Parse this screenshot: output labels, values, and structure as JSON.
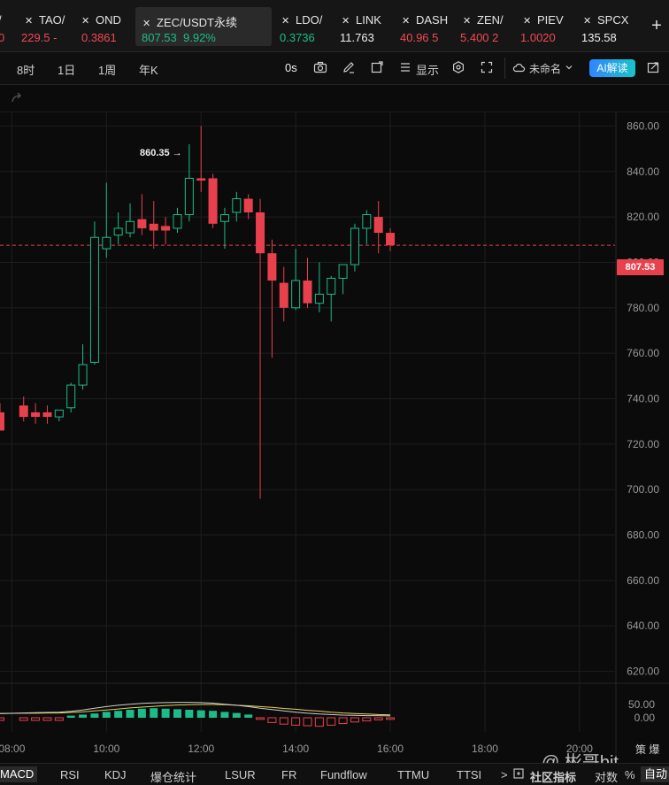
{
  "tickers": [
    {
      "symbol": "/",
      "price": "0",
      "change": "",
      "price_color": "#f24957",
      "change_color": "#f24957"
    },
    {
      "symbol": "TAO/",
      "price": "229.5",
      "change": "-",
      "price_color": "#f24957",
      "change_color": "#f24957"
    },
    {
      "symbol": "OND",
      "price": "0.3861",
      "change": "",
      "price_color": "#f24957",
      "change_color": "#f24957"
    },
    {
      "symbol": "ZEC/USDT永续",
      "price": "807.53",
      "change": "9.92%",
      "price_color": "#1dbb8a",
      "change_color": "#1dbb8a"
    },
    {
      "symbol": "LDO/",
      "price": "0.3736",
      "change": "",
      "price_color": "#1dbb8a",
      "change_color": "#1dbb8a"
    },
    {
      "symbol": "LINK",
      "price": "11.763",
      "change": "",
      "price_color": "#f0f0f0",
      "change_color": "#f0f0f0"
    },
    {
      "symbol": "DASH",
      "price": "40.96",
      "change": "5",
      "price_color": "#f24957",
      "change_color": "#f24957"
    },
    {
      "symbol": "ZEN/",
      "price": "5.400",
      "change": "2",
      "price_color": "#f24957",
      "change_color": "#f24957"
    },
    {
      "symbol": "PIEV",
      "price": "1.0020",
      "change": "",
      "price_color": "#f24957",
      "change_color": "#f24957"
    },
    {
      "symbol": "SPCX",
      "price": "135.58",
      "change": "",
      "price_color": "#f0f0f0",
      "change_color": "#f0f0f0"
    }
  ],
  "toolbar": {
    "interval_8h": "8时",
    "interval_1d": "1日",
    "interval_1w": "1周",
    "interval_1y": "年K",
    "timer": "0s",
    "display": "显示",
    "template": "未命名",
    "ai": "AI解读"
  },
  "bottom_tabs": [
    "MACD",
    "RSI",
    "KDJ",
    "爆仓统计",
    "LSUR",
    "FR",
    "Fundflow",
    "TTMU",
    "TTSI"
  ],
  "bottom_right": {
    "chevron": ">",
    "community": "社区指标",
    "log": "对数",
    "pct": "%",
    "auto": "自动"
  },
  "watermark": "@ 彬哥bit",
  "side_text": "策 爆",
  "colors": {
    "up": "#1dbb8a",
    "down": "#e8414d",
    "background": "#0b0b0b"
  },
  "chart_data": {
    "type": "candlestick",
    "symbol": "ZEC/USDT永续",
    "current_price": "807.53",
    "high_label": "860.35",
    "y_ticks": [
      "860.00",
      "840.00",
      "820.00",
      "800.00",
      "780.00",
      "760.00",
      "740.00",
      "720.00",
      "700.00",
      "680.00",
      "660.00",
      "640.00",
      "620.00"
    ],
    "ylim": [
      614,
      866
    ],
    "x_ticks": [
      "08:00",
      "10:00",
      "12:00",
      "14:00",
      "16:00",
      "18:00",
      "20:00"
    ],
    "x_range": [
      "07:45",
      "20:45"
    ],
    "candles": [
      {
        "t": "07:45",
        "o": 734,
        "h": 738,
        "c": 726,
        "l": 727
      },
      {
        "t": "08:15",
        "o": 737,
        "h": 741,
        "c": 732,
        "l": 730
      },
      {
        "t": "08:30",
        "o": 734,
        "h": 738,
        "c": 732,
        "l": 729
      },
      {
        "t": "08:45",
        "o": 734,
        "h": 737,
        "c": 732,
        "l": 729
      },
      {
        "t": "09:00",
        "o": 732,
        "h": 735,
        "c": 735,
        "l": 730
      },
      {
        "t": "09:15",
        "o": 736,
        "h": 747,
        "c": 746,
        "l": 734
      },
      {
        "t": "09:30",
        "o": 746,
        "h": 764,
        "c": 755,
        "l": 744
      },
      {
        "t": "09:45",
        "o": 756,
        "h": 818,
        "c": 811,
        "l": 755
      },
      {
        "t": "10:00",
        "o": 806,
        "h": 835,
        "c": 811,
        "l": 802
      },
      {
        "t": "10:15",
        "o": 812,
        "h": 822,
        "c": 815,
        "l": 808
      },
      {
        "t": "10:30",
        "o": 813,
        "h": 826,
        "c": 818,
        "l": 811
      },
      {
        "t": "10:45",
        "o": 819,
        "h": 830,
        "c": 815,
        "l": 812
      },
      {
        "t": "11:00",
        "o": 817,
        "h": 827,
        "c": 814,
        "l": 806
      },
      {
        "t": "11:15",
        "o": 816,
        "h": 820,
        "c": 814,
        "l": 808
      },
      {
        "t": "11:30",
        "o": 815,
        "h": 824,
        "c": 821,
        "l": 813
      },
      {
        "t": "11:45",
        "o": 821,
        "h": 852,
        "c": 837,
        "l": 818
      },
      {
        "t": "12:00",
        "o": 837,
        "h": 860,
        "c": 836,
        "l": 831
      },
      {
        "t": "12:15",
        "o": 837,
        "h": 839,
        "c": 817,
        "l": 815
      },
      {
        "t": "12:30",
        "o": 818,
        "h": 824,
        "c": 821,
        "l": 806
      },
      {
        "t": "12:45",
        "o": 822,
        "h": 831,
        "c": 828,
        "l": 818
      },
      {
        "t": "13:00",
        "o": 828,
        "h": 830,
        "c": 822,
        "l": 819
      },
      {
        "t": "13:15",
        "o": 822,
        "h": 828,
        "c": 804,
        "l": 696
      },
      {
        "t": "13:30",
        "o": 804,
        "h": 810,
        "c": 792,
        "l": 758
      },
      {
        "t": "13:45",
        "o": 791,
        "h": 798,
        "c": 780,
        "l": 774
      },
      {
        "t": "14:00",
        "o": 780,
        "h": 806,
        "c": 792,
        "l": 779
      },
      {
        "t": "14:15",
        "o": 792,
        "h": 802,
        "c": 782,
        "l": 780
      },
      {
        "t": "14:30",
        "o": 782,
        "h": 800,
        "c": 786,
        "l": 778
      },
      {
        "t": "14:45",
        "o": 786,
        "h": 794,
        "c": 793,
        "l": 774
      },
      {
        "t": "15:00",
        "o": 793,
        "h": 799,
        "c": 799,
        "l": 786
      },
      {
        "t": "15:15",
        "o": 799,
        "h": 817,
        "c": 815,
        "l": 796
      },
      {
        "t": "15:30",
        "o": 815,
        "h": 823,
        "c": 821,
        "l": 808
      },
      {
        "t": "15:45",
        "o": 820,
        "h": 827,
        "c": 813,
        "l": 804
      },
      {
        "t": "16:00",
        "o": 813,
        "h": 815,
        "c": 807.53,
        "l": 805
      }
    ],
    "macd": {
      "y_ticks": [
        "50.00",
        "0.00"
      ],
      "ylim": [
        -6,
        12
      ],
      "histogram": [
        -1,
        -1,
        -1,
        -1,
        -1,
        0.8,
        1.2,
        1.6,
        2.2,
        2.6,
        3.0,
        3.4,
        3.6,
        3.4,
        3.2,
        3.0,
        2.8,
        2.6,
        2.2,
        1.8,
        1.2,
        -0.6,
        -1.8,
        -2.4,
        -2.8,
        -3.0,
        -3.2,
        -2.8,
        -2.2,
        -1.6,
        -1.2,
        -0.8,
        -0.6
      ],
      "dif": [
        1.6,
        1.8,
        1.9,
        2.0,
        2.1,
        2.4,
        2.9,
        3.6,
        4.2,
        4.7,
        5.1,
        5.4,
        5.6,
        5.7,
        5.8,
        5.8,
        5.7,
        5.5,
        5.1,
        4.7,
        4.2,
        3.6,
        3.1,
        2.6,
        2.1,
        1.7,
        1.4,
        1.2,
        1.0,
        0.9,
        0.8,
        0.8,
        0.7
      ],
      "dea": [
        1.6,
        1.7,
        1.7,
        1.8,
        1.8,
        2.0,
        2.2,
        2.6,
        2.9,
        3.3,
        3.7,
        4.0,
        4.3,
        4.6,
        4.8,
        4.9,
        5.0,
        5.0,
        4.9,
        4.7,
        4.5,
        4.2,
        3.9,
        3.5,
        3.2,
        2.8,
        2.5,
        2.1,
        1.8,
        1.6,
        1.4,
        1.2,
        1.1
      ]
    }
  }
}
